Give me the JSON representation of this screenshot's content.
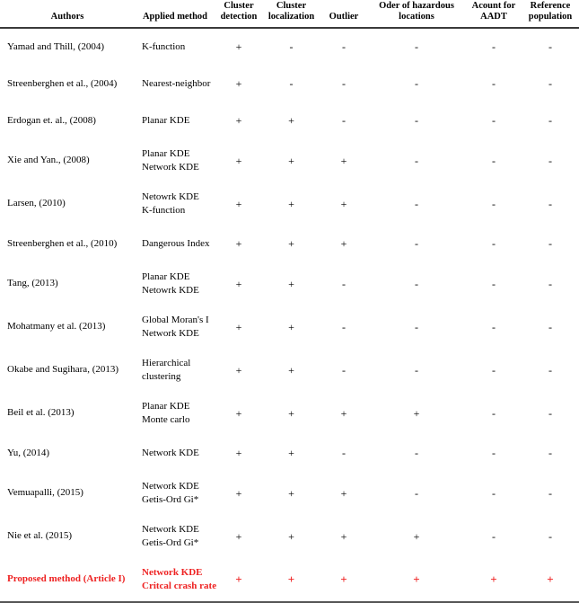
{
  "table": {
    "name": "literature-comparison-table",
    "columns": [
      {
        "key": "authors",
        "label": "Authors"
      },
      {
        "key": "method",
        "label": "Applied method"
      },
      {
        "key": "cluster_detection",
        "label": "Cluster\ndetection",
        "line1": "Cluster",
        "line2": "detection"
      },
      {
        "key": "cluster_localization",
        "label": "Cluster\nlocalization",
        "line1": "Cluster",
        "line2": "localization"
      },
      {
        "key": "outlier",
        "label": "Outlier",
        "line1": "Outlier",
        "line2": ""
      },
      {
        "key": "order_hazard",
        "label": "Oder of hazardous\nlocations",
        "line1": "Oder of hazardous",
        "line2": "locations"
      },
      {
        "key": "aadt",
        "label": "Acount for\nAADT",
        "line1": "Acount for",
        "line2": "AADT"
      },
      {
        "key": "ref_pop",
        "label": "Reference\npopulation",
        "line1": "Reference",
        "line2": "population"
      }
    ],
    "symbols": {
      "yes": "+",
      "no": "-"
    },
    "highlight_color": "#ee2222",
    "rows": [
      {
        "authors": "Yamad and Thill, (2004)",
        "method_lines": [
          "K-function"
        ],
        "marks": [
          "+",
          "-",
          "-",
          "-",
          "-",
          "-"
        ],
        "highlight": false
      },
      {
        "authors": "Streenberghen et al., (2004)",
        "method_lines": [
          "Nearest-neighbor"
        ],
        "marks": [
          "+",
          "-",
          "-",
          "-",
          "-",
          "-"
        ],
        "highlight": false
      },
      {
        "authors": "Erdogan et. al., (2008)",
        "method_lines": [
          "Planar KDE"
        ],
        "marks": [
          "+",
          "+",
          "-",
          "-",
          "-",
          "-"
        ],
        "highlight": false
      },
      {
        "authors": "Xie and Yan., (2008)",
        "method_lines": [
          "Planar KDE",
          "Network KDE"
        ],
        "marks": [
          "+",
          "+",
          "+",
          "-",
          "-",
          "-"
        ],
        "highlight": false
      },
      {
        "authors": "Larsen, (2010)",
        "method_lines": [
          "Netowrk KDE",
          "K-function"
        ],
        "marks": [
          "+",
          "+",
          "+",
          "-",
          "-",
          "-"
        ],
        "highlight": false
      },
      {
        "authors": "Streenberghen et al., (2010)",
        "method_lines": [
          "Dangerous Index"
        ],
        "marks": [
          "+",
          "+",
          "+",
          "-",
          "-",
          "-"
        ],
        "highlight": false
      },
      {
        "authors": "Tang, (2013)",
        "method_lines": [
          "Planar KDE",
          "Netowrk KDE"
        ],
        "marks": [
          "+",
          "+",
          "-",
          "-",
          "-",
          "-"
        ],
        "highlight": false
      },
      {
        "authors": "Mohatmany et al. (2013)",
        "method_lines": [
          "Global Moran's I",
          "Network KDE"
        ],
        "marks": [
          "+",
          "+",
          "-",
          "-",
          "-",
          "-"
        ],
        "highlight": false
      },
      {
        "authors": "Okabe and Sugihara, (2013)",
        "method_lines": [
          "Hierarchical",
          "clustering"
        ],
        "marks": [
          "+",
          "+",
          "-",
          "-",
          "-",
          "-"
        ],
        "highlight": false
      },
      {
        "authors": "Beil et al. (2013)",
        "method_lines": [
          "Planar KDE",
          "Monte carlo"
        ],
        "marks": [
          "+",
          "+",
          "+",
          "+",
          "-",
          "-"
        ],
        "highlight": false
      },
      {
        "authors": "Yu, (2014)",
        "method_lines": [
          "Network KDE"
        ],
        "marks": [
          "+",
          "+",
          "-",
          "-",
          "-",
          "-"
        ],
        "highlight": false
      },
      {
        "authors": "Vemuapalli, (2015)",
        "method_lines": [
          "Network KDE",
          "Getis-Ord Gi*"
        ],
        "marks": [
          "+",
          "+",
          "+",
          "-",
          "-",
          "-"
        ],
        "highlight": false
      },
      {
        "authors": "Nie et al. (2015)",
        "method_lines": [
          "Network KDE",
          "Getis-Ord Gi*"
        ],
        "marks": [
          "+",
          "+",
          "+",
          "+",
          "-",
          "-"
        ],
        "highlight": false
      },
      {
        "authors": "Proposed method (Article I)",
        "method_lines": [
          "Network KDE",
          "Critcal crash rate"
        ],
        "marks": [
          "+",
          "+",
          "+",
          "+",
          "+",
          "+"
        ],
        "highlight": true
      }
    ]
  }
}
